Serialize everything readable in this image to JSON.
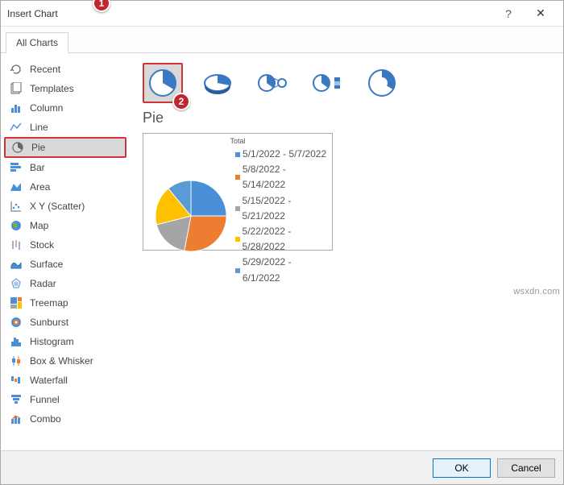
{
  "title": "Insert Chart",
  "tab_label": "All Charts",
  "sidebar": {
    "items": [
      {
        "label": "Recent"
      },
      {
        "label": "Templates"
      },
      {
        "label": "Column"
      },
      {
        "label": "Line"
      },
      {
        "label": "Pie"
      },
      {
        "label": "Bar"
      },
      {
        "label": "Area"
      },
      {
        "label": "X Y (Scatter)"
      },
      {
        "label": "Map"
      },
      {
        "label": "Stock"
      },
      {
        "label": "Surface"
      },
      {
        "label": "Radar"
      },
      {
        "label": "Treemap"
      },
      {
        "label": "Sunburst"
      },
      {
        "label": "Histogram"
      },
      {
        "label": "Box & Whisker"
      },
      {
        "label": "Waterfall"
      },
      {
        "label": "Funnel"
      },
      {
        "label": "Combo"
      }
    ]
  },
  "chart_type_title": "Pie",
  "preview_title": "Total",
  "legend_items": [
    "5/1/2022 - 5/7/2022",
    "5/8/2022 - 5/14/2022",
    "5/15/2022 - 5/21/2022",
    "5/22/2022 - 5/28/2022",
    "5/29/2022 - 6/1/2022"
  ],
  "buttons": {
    "ok": "OK",
    "cancel": "Cancel"
  },
  "callouts": {
    "c1": "1",
    "c2": "2"
  },
  "help_glyph": "?",
  "close_glyph": "✕",
  "watermark": "wsxdn.com",
  "chart_data": {
    "type": "pie",
    "title": "Total",
    "categories": [
      "5/1/2022 - 5/7/2022",
      "5/8/2022 - 5/14/2022",
      "5/15/2022 - 5/21/2022",
      "5/22/2022 - 5/28/2022",
      "5/29/2022 - 6/1/2022"
    ],
    "values": [
      25,
      28,
      18,
      18,
      11
    ],
    "colors": [
      "#4a90d9",
      "#ed7d31",
      "#a5a5a5",
      "#ffc000",
      "#5b9bd5"
    ]
  }
}
